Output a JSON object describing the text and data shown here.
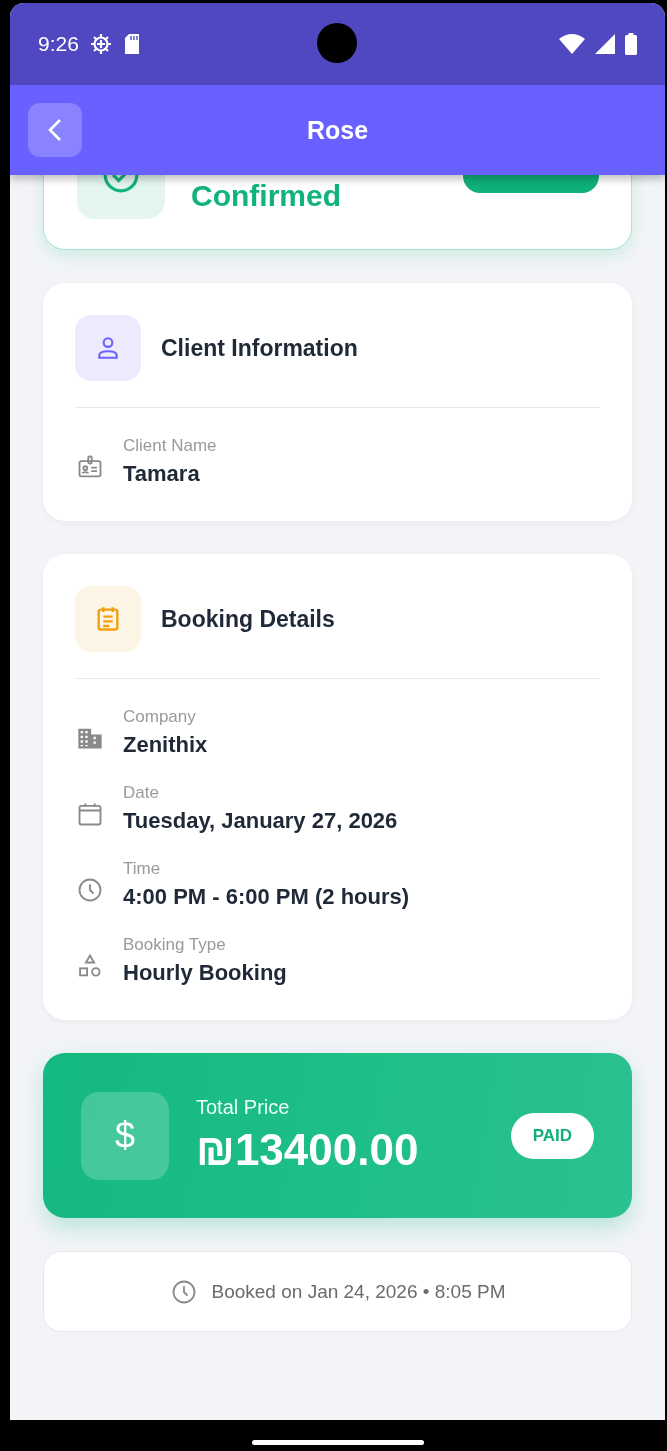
{
  "status_bar": {
    "time": "9:26"
  },
  "app_bar": {
    "title": "Rose"
  },
  "status_card": {
    "title": "Confirmed"
  },
  "sections": [
    {
      "kind": "client",
      "title": "Client Information",
      "fields": [
        {
          "kind": "id",
          "label": "Client Name",
          "value": "Tamara"
        }
      ]
    },
    {
      "kind": "booking",
      "title": "Booking Details",
      "fields": [
        {
          "kind": "company",
          "label": "Company",
          "value": "Zenithix"
        },
        {
          "kind": "date",
          "label": "Date",
          "value": "Tuesday, January 27, 2026"
        },
        {
          "kind": "time",
          "label": "Time",
          "value": "4:00 PM - 6:00 PM (2 hours)"
        },
        {
          "kind": "type",
          "label": "Booking Type",
          "value": "Hourly Booking"
        }
      ]
    }
  ],
  "price": {
    "icon": "$",
    "label": "Total Price",
    "amount": "₪13400.00",
    "badge": "PAID"
  },
  "footer": {
    "text": "Booked on Jan 24, 2026 • 8:05 PM"
  }
}
